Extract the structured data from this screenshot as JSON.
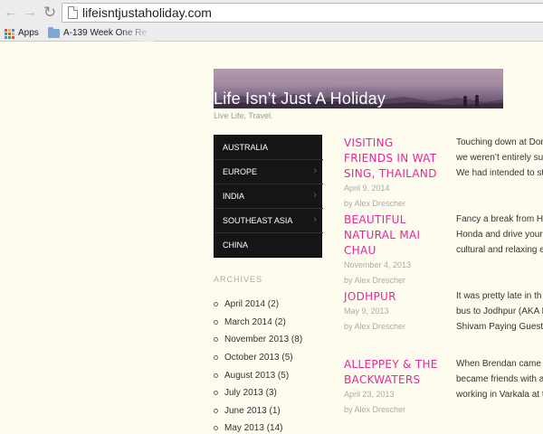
{
  "browser": {
    "url": "lifeisntjustaholiday.com",
    "bookmarks": [
      {
        "label": "Apps",
        "icon": "apps-grid-icon"
      },
      {
        "label": "A-139 Week One Re",
        "icon": "folder-icon"
      }
    ]
  },
  "site": {
    "title": "Life Isn’t Just A Holiday",
    "tagline": "Live Life. Travel."
  },
  "menu": [
    {
      "label": "AUSTRALIA",
      "has_children": false
    },
    {
      "label": "EUROPE",
      "has_children": true
    },
    {
      "label": "INDIA",
      "has_children": true
    },
    {
      "label": "SOUTHEAST ASIA",
      "has_children": true
    },
    {
      "label": "CHINA",
      "has_children": false
    }
  ],
  "archives": {
    "title": "ARCHIVES",
    "items": [
      "April 2014 (2)",
      "March 2014 (2)",
      "November 2013 (8)",
      "October 2013 (5)",
      "August 2013 (5)",
      "July 2013 (3)",
      "June 2013 (1)",
      "May 2013 (14)"
    ]
  },
  "posts": [
    {
      "title": "VISITING FRIENDS IN WAT SING, THAILAND",
      "date": "April 9, 2014",
      "author": "by Alex Drescher",
      "excerpt": [
        "Touching down at Don",
        "we weren’t entirely su",
        "We had intended to st"
      ]
    },
    {
      "title": "BEAUTIFUL NATURAL MAI CHAU",
      "date": "November 4, 2013",
      "author": "by Alex Drescher",
      "excerpt": [
        "Fancy a break from H",
        "Honda and drive your",
        "cultural and relaxing e"
      ]
    },
    {
      "title": "JODHPUR",
      "date": "May 9, 2013",
      "author": "by Alex Drescher",
      "excerpt": [
        "It was pretty late in th",
        "bus to Jodhpur (AKA I",
        "Shivam Paying Guestl"
      ]
    },
    {
      "title": "ALLEPPEY & THE BACKWATERS",
      "date": "April 23, 2013",
      "author": "by Alex Drescher",
      "excerpt": [
        "When Brendan came t",
        "became friends with a",
        "working in Varkala at t"
      ]
    }
  ],
  "colors": {
    "accent_pink": "#e8259a",
    "menu_bg": "#151515",
    "page_bg": "#fdfcef"
  }
}
